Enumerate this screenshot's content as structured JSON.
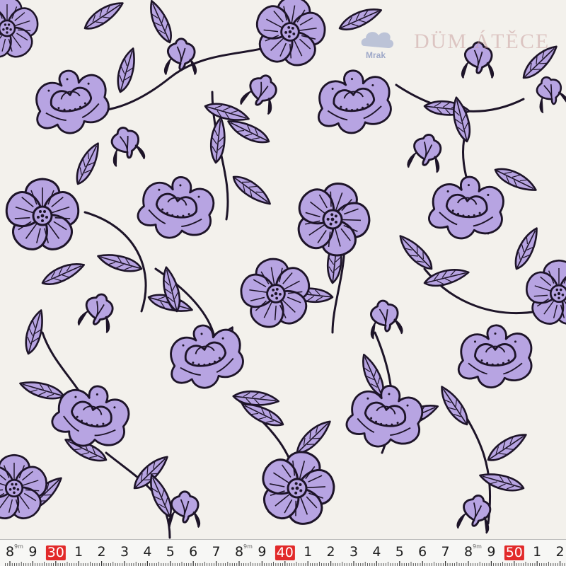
{
  "image": {
    "subject": "floral printed fabric swatch with measuring tape",
    "colors": {
      "background": "#f3f1ec",
      "petal_fill": "#b7a4e2",
      "shadow": "#8f7fc5",
      "outline": "#1d1428",
      "ruler_bg": "#f7f7f5",
      "ruler_major_marker": "#e22a2a"
    }
  },
  "watermark": {
    "logo_text": "Mrak",
    "brand_text": "DÜM ÁTĚCE"
  },
  "ruler": {
    "unit": "cm",
    "labels": [
      {
        "text": "8",
        "sub": "9m",
        "major": false
      },
      {
        "text": "9",
        "major": false
      },
      {
        "text": "30",
        "major": true
      },
      {
        "text": "1",
        "major": false
      },
      {
        "text": "2",
        "major": false
      },
      {
        "text": "3",
        "major": false
      },
      {
        "text": "4",
        "major": false
      },
      {
        "text": "5",
        "major": false
      },
      {
        "text": "6",
        "major": false
      },
      {
        "text": "7",
        "major": false
      },
      {
        "text": "8",
        "sub": "9m",
        "major": false
      },
      {
        "text": "9",
        "major": false
      },
      {
        "text": "40",
        "major": true
      },
      {
        "text": "1",
        "major": false
      },
      {
        "text": "2",
        "major": false
      },
      {
        "text": "3",
        "major": false
      },
      {
        "text": "4",
        "major": false
      },
      {
        "text": "5",
        "major": false
      },
      {
        "text": "6",
        "major": false
      },
      {
        "text": "7",
        "major": false
      },
      {
        "text": "8",
        "sub": "9m",
        "major": false
      },
      {
        "text": "9",
        "major": false
      },
      {
        "text": "50",
        "major": true
      },
      {
        "text": "1",
        "major": false
      },
      {
        "text": "2",
        "major": false
      }
    ]
  }
}
